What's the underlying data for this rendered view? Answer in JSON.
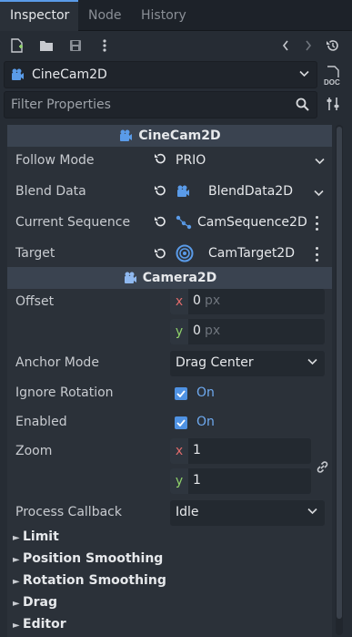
{
  "tabs": [
    {
      "label": "Inspector",
      "active": true
    },
    {
      "label": "Node",
      "active": false
    },
    {
      "label": "History",
      "active": false
    }
  ],
  "toolbar": {
    "icons": [
      "new-resource-icon",
      "open-folder-icon",
      "save-icon",
      "more-icon",
      "back-icon",
      "forward-icon",
      "history-icon"
    ]
  },
  "object_selector": {
    "label": "CineCam2D"
  },
  "doc_button": {
    "label": "DOC"
  },
  "filter": {
    "placeholder": "Filter Properties"
  },
  "sections": {
    "cinecam": {
      "title": "CineCam2D"
    },
    "camera2d": {
      "title": "Camera2D"
    }
  },
  "properties": {
    "follow_mode": {
      "label": "Follow Mode",
      "value": "PRIO"
    },
    "blend_data": {
      "label": "Blend Data",
      "value": "BlendData2D"
    },
    "current_sequence": {
      "label": "Current Sequence",
      "value": "CamSequence2D"
    },
    "target": {
      "label": "Target",
      "value": "CamTarget2D"
    },
    "offset": {
      "label": "Offset",
      "x": "0",
      "y": "0",
      "unit": "px"
    },
    "anchor_mode": {
      "label": "Anchor Mode",
      "value": "Drag Center"
    },
    "ignore_rotation": {
      "label": "Ignore Rotation",
      "value": "On"
    },
    "enabled": {
      "label": "Enabled",
      "value": "On"
    },
    "zoom": {
      "label": "Zoom",
      "x": "1",
      "y": "1"
    },
    "process_callback": {
      "label": "Process Callback",
      "value": "Idle"
    }
  },
  "axes": {
    "x": "x",
    "y": "y"
  },
  "groups": [
    "Limit",
    "Position Smoothing",
    "Rotation Smoothing",
    "Drag",
    "Editor"
  ],
  "colors": {
    "accent": "#5a9be8",
    "checkbox": "#4f92e3",
    "on_text": "#6ea9ef",
    "axis_x": "#e16b6b",
    "axis_y": "#8fd16b"
  }
}
